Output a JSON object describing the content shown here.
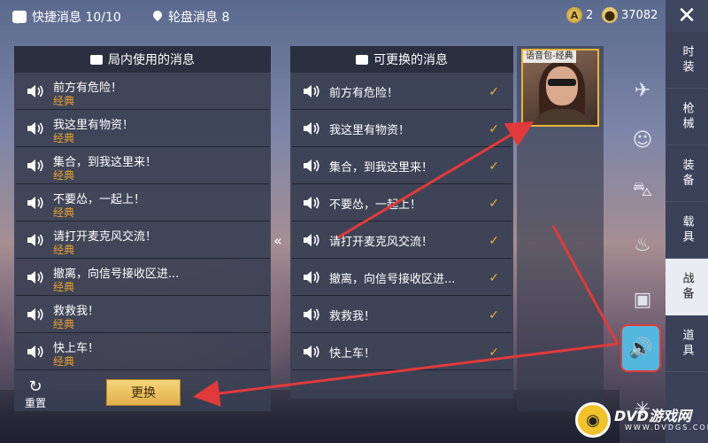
{
  "topbar": {
    "quick_msg_label": "快捷消息 10/10",
    "wheel_msg_label": "轮盘消息 8",
    "currency_a_symbol": "A",
    "currency_a_value": "2",
    "currency_b_value": "37082",
    "close_symbol": "✕"
  },
  "left_panel": {
    "title": "局内使用的消息",
    "messages": [
      {
        "text": "前方有危险！",
        "sub": "经典"
      },
      {
        "text": "我这里有物资！",
        "sub": "经典"
      },
      {
        "text": "集合，到我这里来！",
        "sub": "经典"
      },
      {
        "text": "不要怂，一起上！",
        "sub": "经典"
      },
      {
        "text": "请打开麦克风交流！",
        "sub": "经典"
      },
      {
        "text": "撤离，向信号接收区进...",
        "sub": "经典"
      },
      {
        "text": "救救我！",
        "sub": "经典"
      },
      {
        "text": "快上车！",
        "sub": "经典"
      }
    ],
    "reset_label": "重置",
    "swap_label": "更换",
    "collapse_symbol": "«"
  },
  "mid_panel": {
    "title": "可更换的消息",
    "messages": [
      "前方有危险！",
      "我这里有物资！",
      "集合，到我这里来！",
      "不要怂，一起上！",
      "请打开麦克风交流！",
      "撤离，向信号接收区进...",
      "救救我！",
      "快上车！"
    ],
    "check": "✓"
  },
  "item_card": {
    "tag": "语音包-经典",
    "equipped_check": "✓"
  },
  "category_icons": [
    "plane-icon",
    "emote-icon",
    "vehicle-icon",
    "spray-icon",
    "image-icon",
    "speaker-icon",
    "firework-icon"
  ],
  "tabs": [
    "时装",
    "枪械",
    "装备",
    "载具",
    "战备",
    "道具"
  ],
  "active_tab": "战备",
  "watermark": {
    "text": "DVD游戏网",
    "sub": "WWW.DVDGS.COM"
  },
  "colors": {
    "accent_gold": "#e7b33a",
    "sub_text_orange": "#e6a030",
    "active_icon_bg": "#54b7e0",
    "annotation_red": "#e23a3a"
  }
}
